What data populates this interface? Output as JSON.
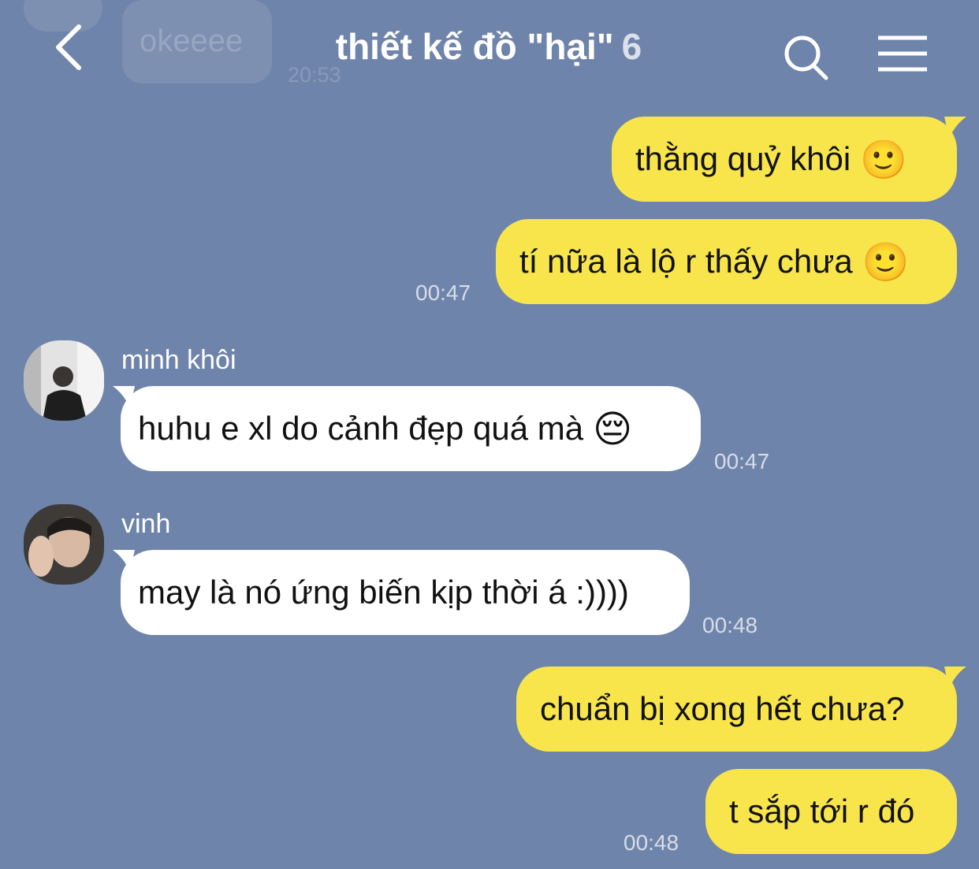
{
  "header": {
    "title": "thiết kế đồ \"hại\"",
    "member_count": "6",
    "back_icon": "chevron-left-icon",
    "search_icon": "search-icon",
    "menu_icon": "menu-icon"
  },
  "background_message": {
    "text": "okeeee",
    "time": "20:53"
  },
  "messages": [
    {
      "from": "me",
      "text": "thằng quỷ khôi",
      "emoji": "🙂"
    },
    {
      "from": "me",
      "text": "tí nữa là lộ r thấy chưa",
      "emoji": "🙂",
      "time": "00:47"
    },
    {
      "from": "minh khôi",
      "sender": "minh khôi",
      "text": "huhu e xl do cảnh đẹp quá mà",
      "emoji": "😔",
      "time": "00:47"
    },
    {
      "from": "vinh",
      "sender": "vinh",
      "text": "may là nó ứng biến kịp thời á :))))",
      "time": "00:48"
    },
    {
      "from": "me",
      "text": "chuẩn bị xong hết chưa?"
    },
    {
      "from": "me",
      "text": "t sắp tới r đó",
      "time": "00:48"
    }
  ],
  "colors": {
    "background": "#6f84aa",
    "my_bubble": "#f8e54b",
    "their_bubble": "#ffffff"
  }
}
